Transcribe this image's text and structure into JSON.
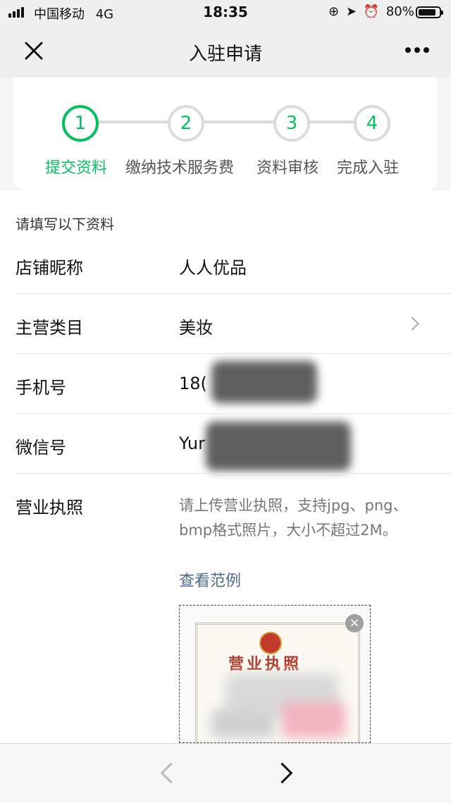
{
  "status_bar": {
    "carrier": "中国移动",
    "network": "4G",
    "time": "18:35",
    "battery": "80%",
    "icons": [
      "signal-icon",
      "rotation-lock-icon",
      "location-icon",
      "alarm-icon",
      "battery-icon"
    ]
  },
  "nav": {
    "title": "入驻申请",
    "close_icon": "close-icon",
    "more_icon": "more-icon"
  },
  "steps": [
    {
      "number": "1",
      "label": "提交资料",
      "active": true
    },
    {
      "number": "2",
      "label": "缴纳技术服务费",
      "active": false
    },
    {
      "number": "3",
      "label": "资料审核",
      "active": false
    },
    {
      "number": "4",
      "label": "完成入驻",
      "active": false
    }
  ],
  "form": {
    "hint": "请填写以下资料",
    "rows": [
      {
        "label": "店铺昵称",
        "value": "人人优品"
      },
      {
        "label": "主营类目",
        "value": "美妆"
      },
      {
        "label": "手机号",
        "value": "18("
      },
      {
        "label": "微信号",
        "value": "Yur"
      }
    ],
    "license": {
      "label": "营业执照",
      "hint": "请上传营业执照，支持jpg、png、bmp格式照片，大小不超过2M。",
      "example_link": "查看范例",
      "image_title": "营业执照"
    }
  },
  "colors": {
    "accent": "#07c160",
    "link": "#4a6a8f",
    "inactive": "#dcdcdc"
  }
}
